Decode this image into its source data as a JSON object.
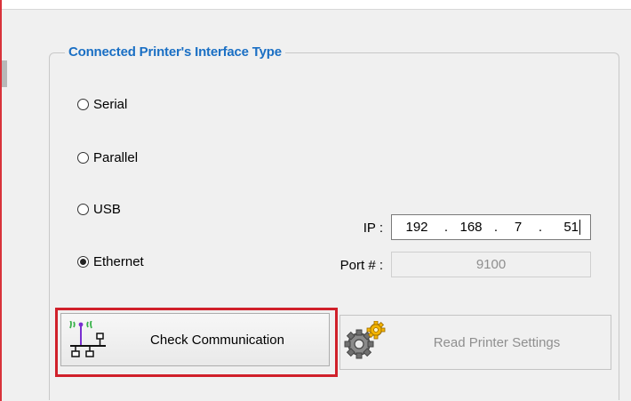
{
  "groupbox": {
    "title": "Connected Printer's Interface Type"
  },
  "interface": {
    "options": [
      {
        "label": "Serial",
        "checked": false
      },
      {
        "label": "Parallel",
        "checked": false
      },
      {
        "label": "USB",
        "checked": false
      },
      {
        "label": "Ethernet",
        "checked": true
      }
    ]
  },
  "ip": {
    "label": "IP :",
    "octets": [
      "192",
      "168",
      "7",
      "51"
    ],
    "separator": "."
  },
  "port": {
    "label": "Port # :",
    "value": "9100"
  },
  "buttons": {
    "check": {
      "label": "Check Communication",
      "icon": "network-antenna-icon"
    },
    "read": {
      "label": "Read Printer Settings",
      "icon": "gears-icon",
      "disabled": true
    }
  },
  "colors": {
    "accent": "#1a6fc4",
    "highlight": "#d0202a"
  }
}
